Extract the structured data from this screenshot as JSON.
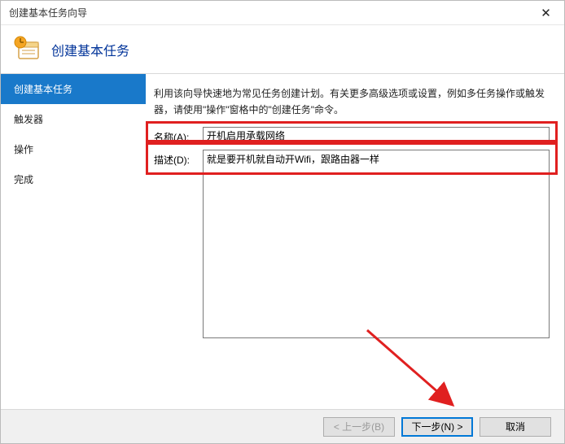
{
  "window": {
    "title": "创建基本任务向导"
  },
  "header": {
    "title": "创建基本任务"
  },
  "sidebar": {
    "items": [
      {
        "label": "创建基本任务",
        "active": true
      },
      {
        "label": "触发器",
        "active": false
      },
      {
        "label": "操作",
        "active": false
      },
      {
        "label": "完成",
        "active": false
      }
    ]
  },
  "main": {
    "intro": "利用该向导快速地为常见任务创建计划。有关更多高级选项或设置，例如多任务操作或触发器，请使用\"操作\"窗格中的\"创建任务\"命令。",
    "name_label": "名称(A):",
    "name_value": "开机启用承载网络",
    "desc_label": "描述(D):",
    "desc_value": "就是要开机就自动开Wifi，跟路由器一样"
  },
  "footer": {
    "back": "< 上一步(B)",
    "next": "下一步(N) >",
    "cancel": "取消"
  }
}
